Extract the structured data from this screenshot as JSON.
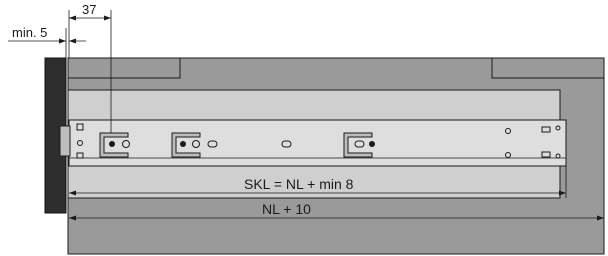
{
  "dimensions": {
    "min_gap_label": "min. 5",
    "offset_label": "37",
    "slide_length_label": "SKL = NL + min 8",
    "depth_label": "NL + 10"
  },
  "colors": {
    "cabinet": "#9a9a9a",
    "drawer_panel": "#cfcfcf",
    "slide_rail": "#dedede",
    "front_panel": "#2e2e2e",
    "line": "#1a1a1a"
  }
}
